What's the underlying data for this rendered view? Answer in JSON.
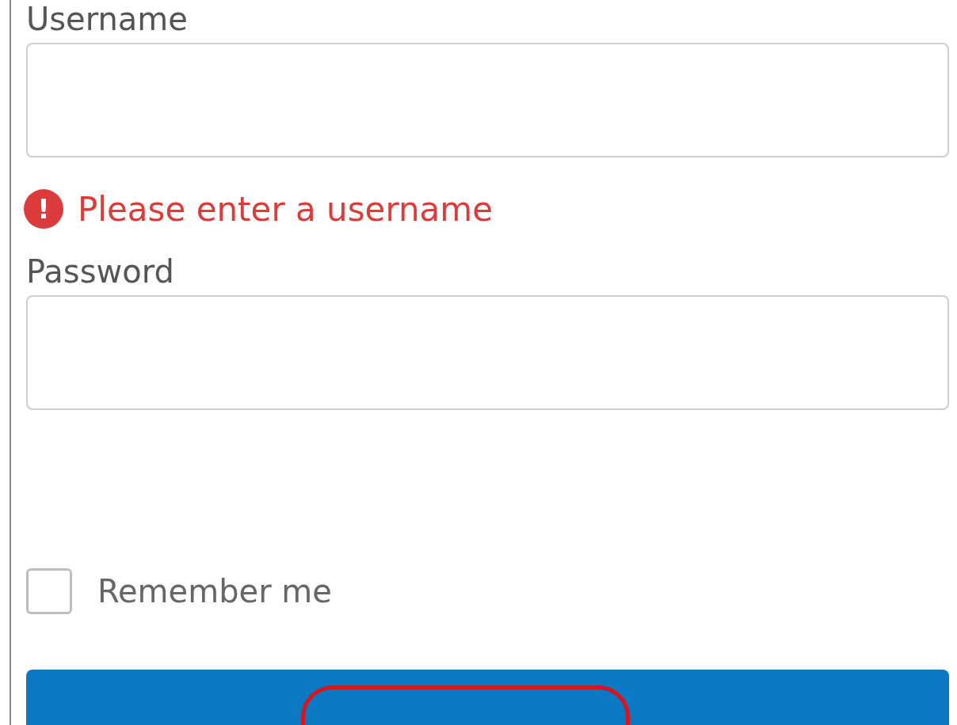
{
  "fields": [
    {
      "label": "Username",
      "error": "Please enter a username",
      "error_icon": "!"
    },
    {
      "label": "Password"
    }
  ],
  "remember": {
    "label": "Remember me",
    "checked": false
  }
}
